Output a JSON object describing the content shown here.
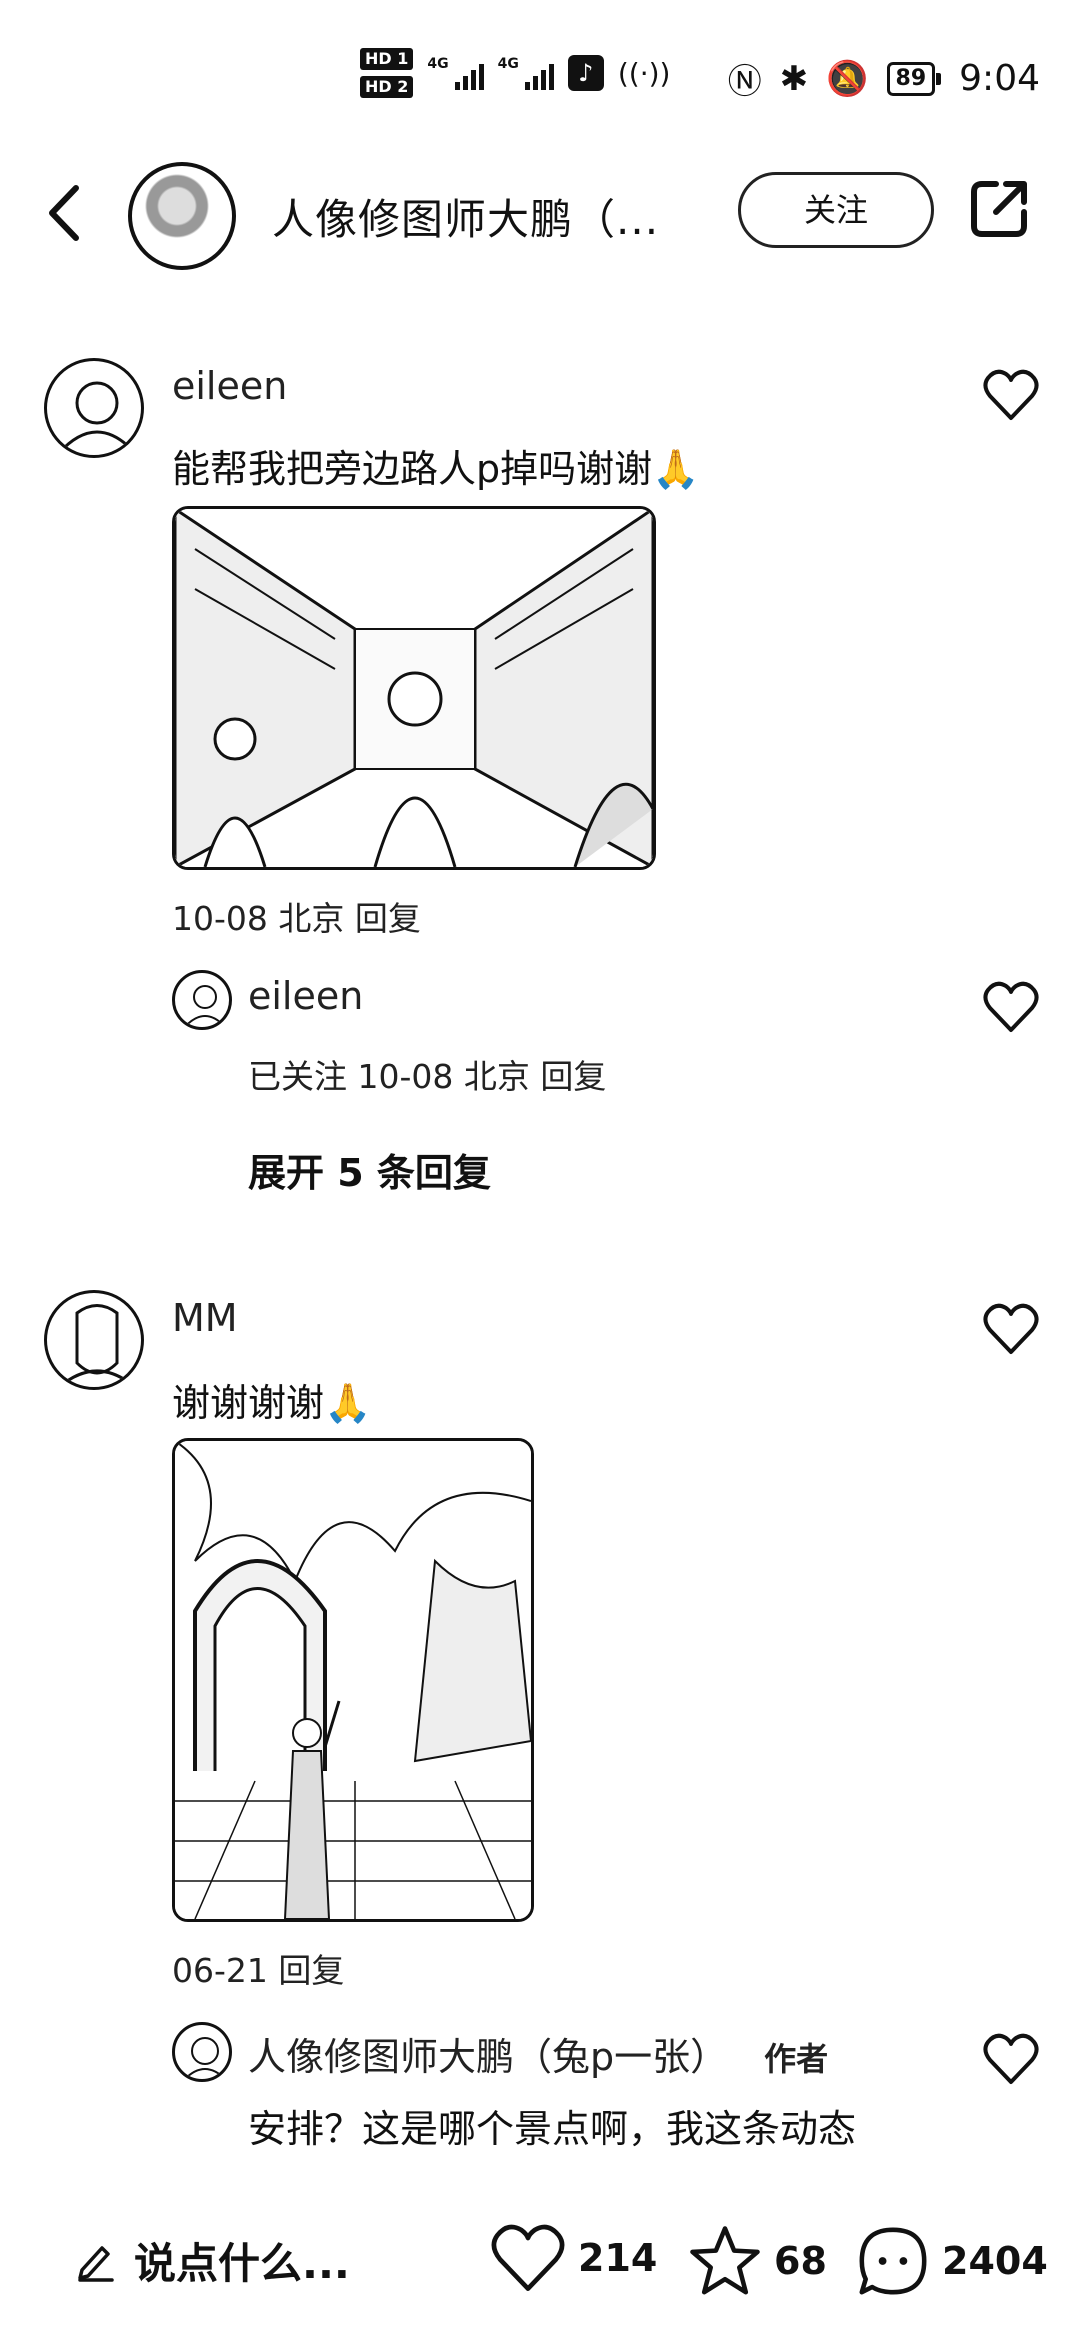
{
  "status_bar": {
    "hd1": "HD 1",
    "hd2": "HD 2",
    "net1": "4G",
    "net2": "4G",
    "battery": "89",
    "time": "9:04"
  },
  "header": {
    "title": "人像修图师大鹏（...",
    "follow_label": "关注"
  },
  "comments": [
    {
      "user": "eileen",
      "text": "能帮我把旁边路人p掉吗谢谢🙏",
      "meta": "10-08 北京 回复",
      "reply": {
        "user": "eileen",
        "meta": "已关注 10-08 北京 回复"
      },
      "expand_label": "展开 5 条回复"
    },
    {
      "user": "MM",
      "text": "谢谢谢谢🙏",
      "meta": "06-21  回复",
      "reply": {
        "user": "人像修图师大鹏（兔p一张）",
        "author_tag": "作者",
        "text": "安排？这是哪个景点啊，我这条动态"
      }
    }
  ],
  "bottom_bar": {
    "input_placeholder": "说点什么...",
    "likes": "214",
    "favorites": "68",
    "comments": "2404"
  }
}
